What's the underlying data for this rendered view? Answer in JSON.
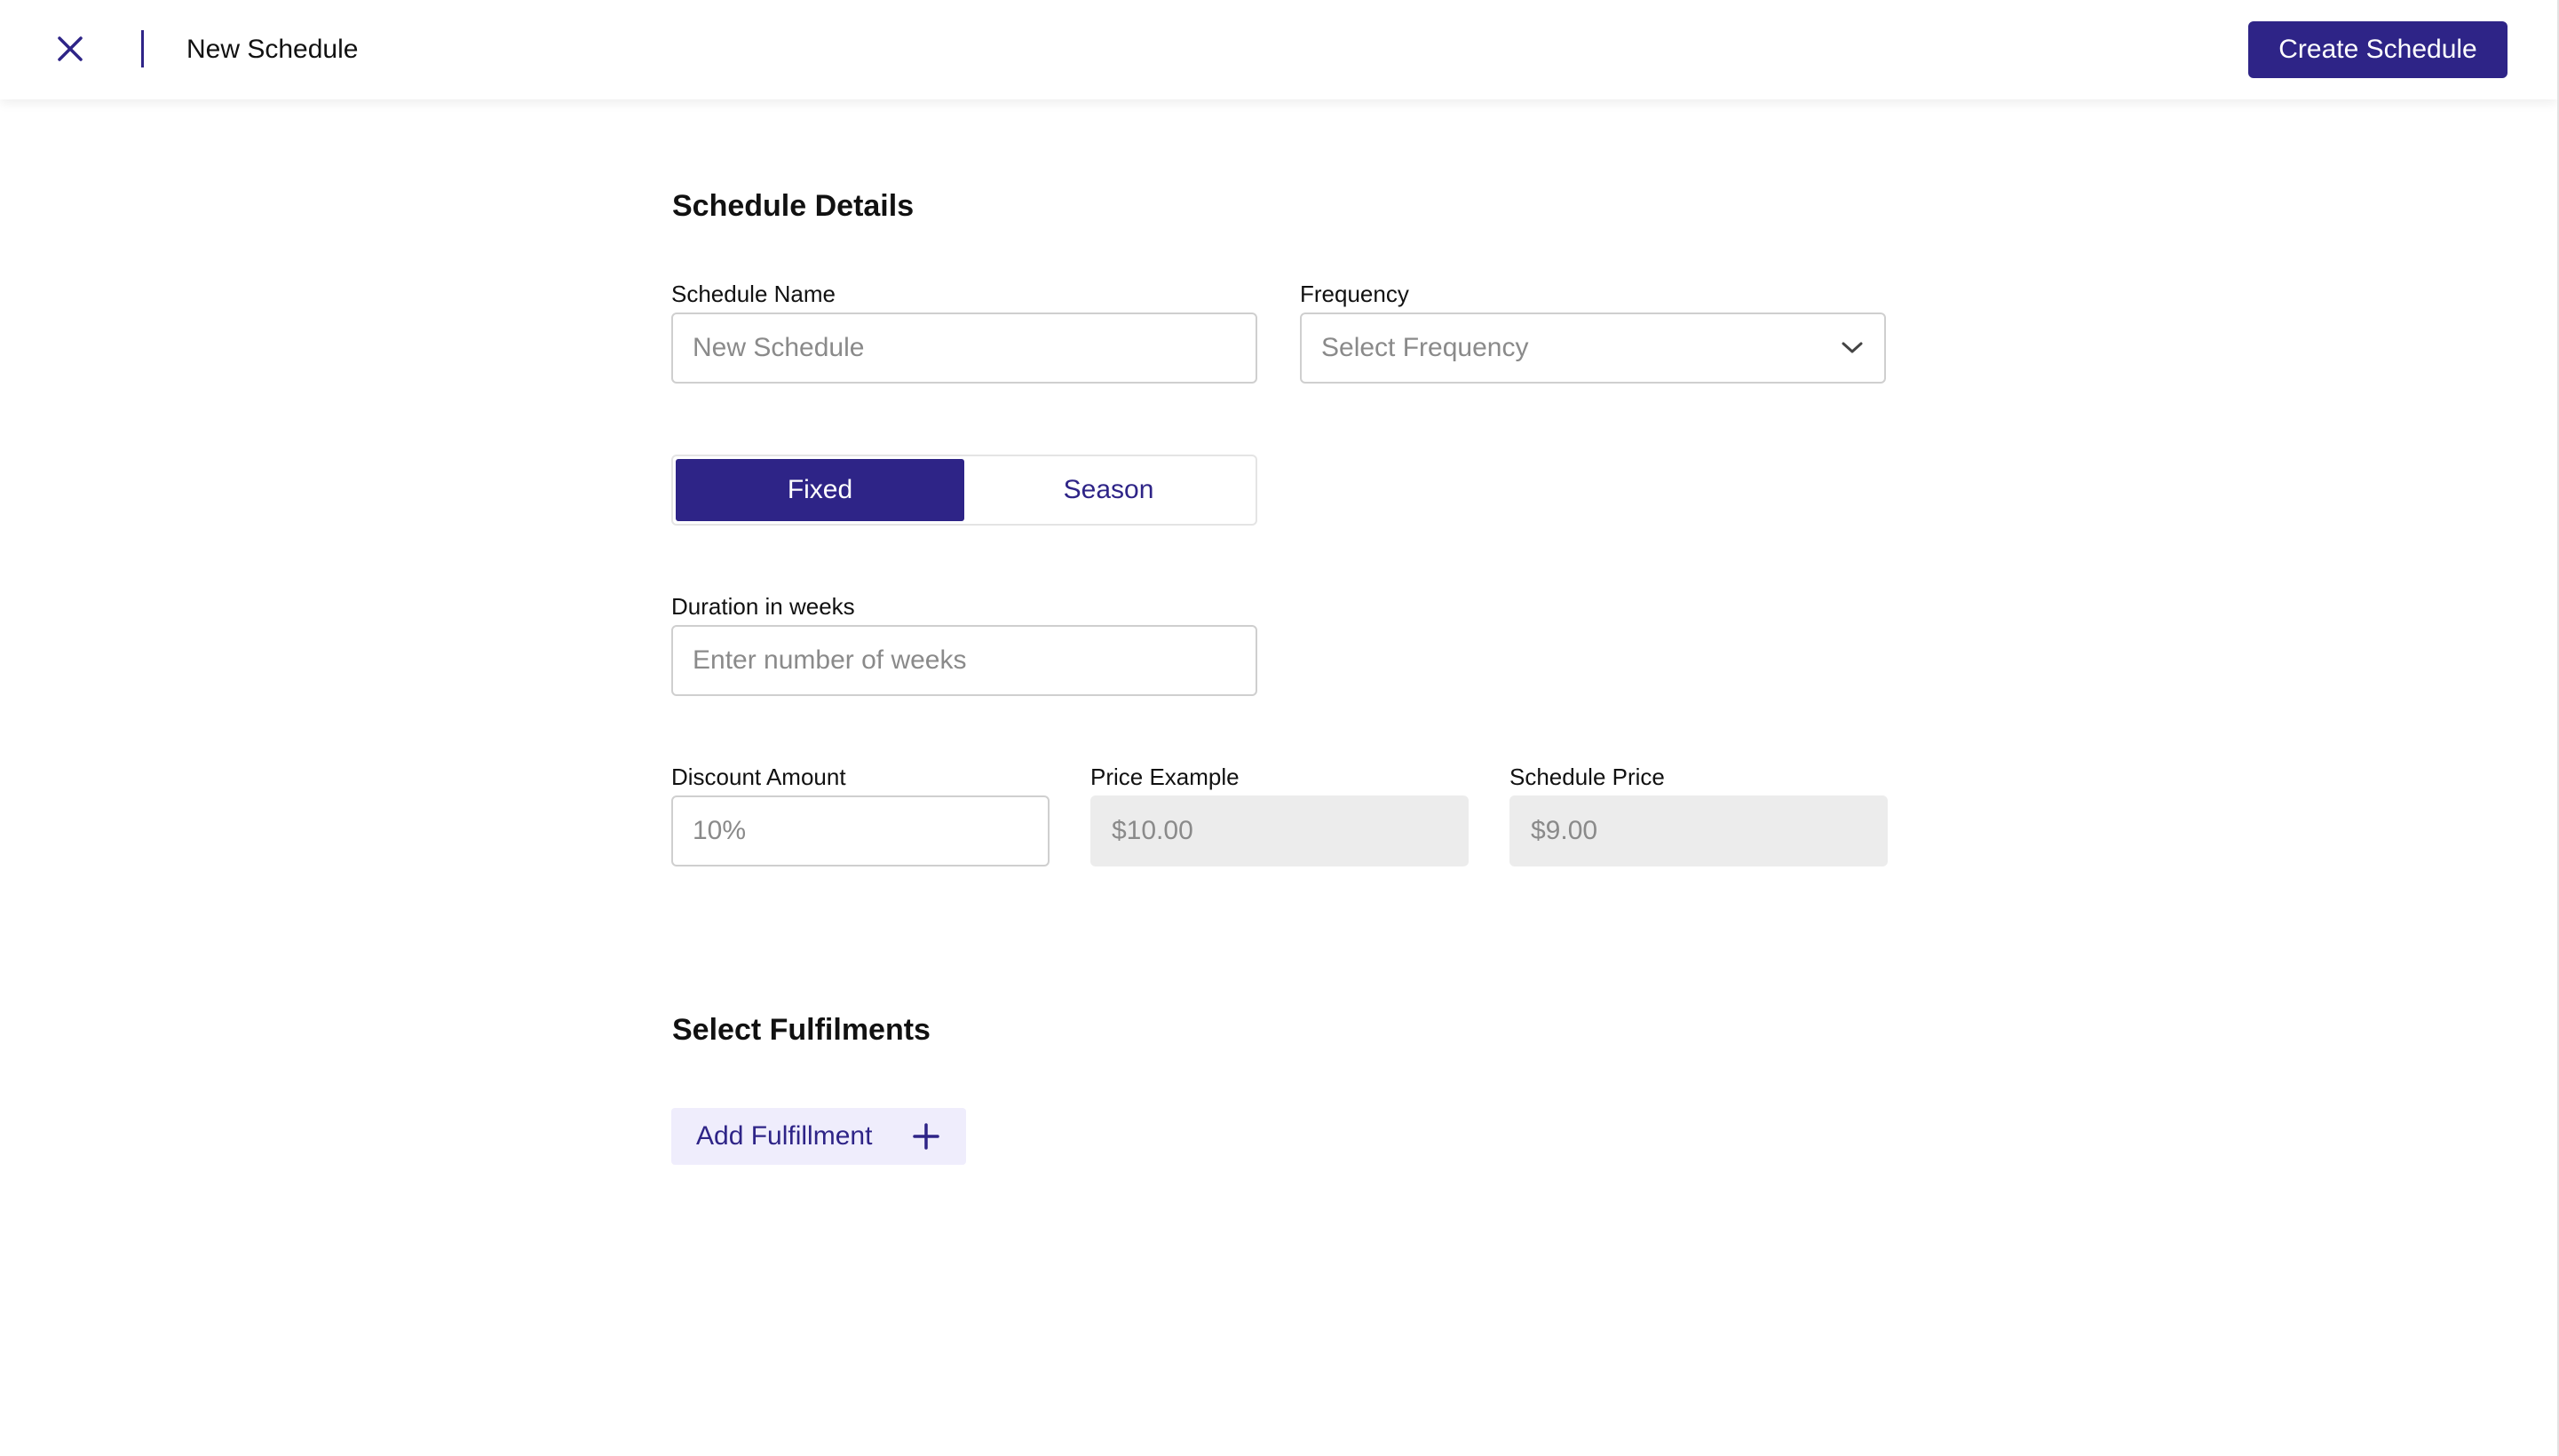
{
  "header": {
    "title": "New Schedule",
    "create_label": "Create Schedule"
  },
  "details": {
    "section_title": "Schedule Details",
    "schedule_name": {
      "label": "Schedule Name",
      "placeholder": "New Schedule"
    },
    "frequency": {
      "label": "Frequency",
      "placeholder": "Select Frequency"
    },
    "type_toggle": {
      "options": [
        "Fixed",
        "Season"
      ],
      "selected": "Fixed"
    },
    "duration": {
      "label": "Duration in weeks",
      "placeholder": "Enter number of weeks"
    },
    "discount": {
      "label": "Discount Amount",
      "placeholder": "10%"
    },
    "price_example": {
      "label": "Price Example",
      "placeholder": "$10.00"
    },
    "schedule_price": {
      "label": "Schedule Price",
      "placeholder": "$9.00"
    }
  },
  "fulfilments": {
    "section_title": "Select Fulfilments",
    "add_label": "Add Fulfillment"
  },
  "icons": {
    "close": "close-icon",
    "dropdown": "chevron-down-icon",
    "add": "plus-icon"
  },
  "colors": {
    "primary": "#2e2487",
    "primary_light": "#efedfc",
    "readonly_bg": "#ececec",
    "border": "#cfcfcf"
  }
}
